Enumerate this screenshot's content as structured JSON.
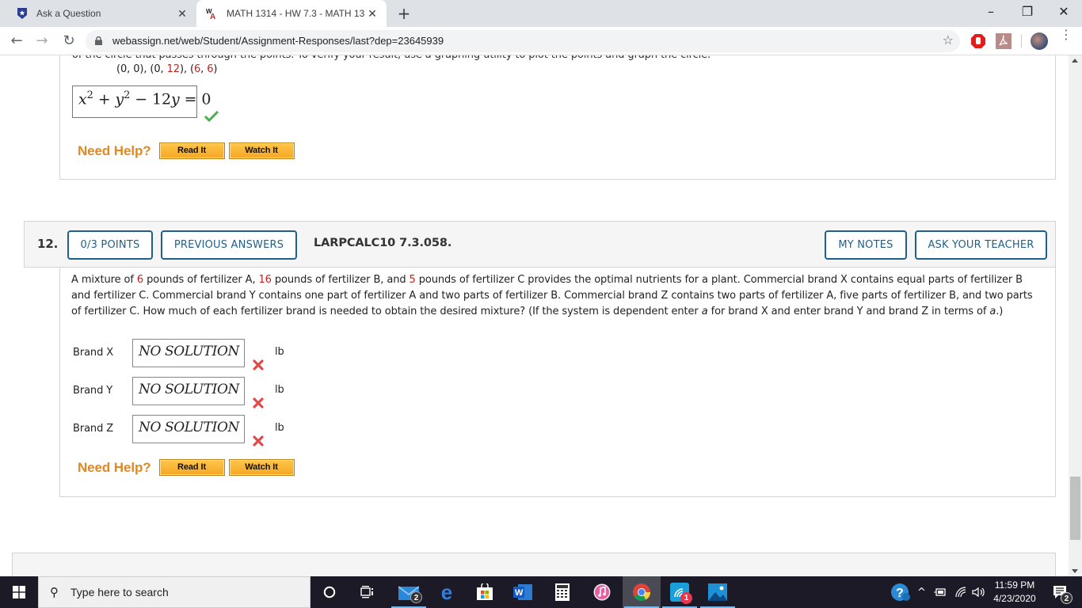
{
  "browser": {
    "tabs": [
      {
        "title": "Ask a Question",
        "icon": "shield-star-icon",
        "active": false
      },
      {
        "title": "MATH 1314 - HW 7.3 - MATH 13",
        "icon": "webassign-icon",
        "active": true
      }
    ],
    "new_tab": "+",
    "window_controls": {
      "minimize": "–",
      "restore": "❐",
      "close": "✕"
    },
    "nav": {
      "back": "←",
      "forward": "→",
      "reload": "↻"
    },
    "url": "webassign.net/web/Student/Assignment-Responses/last?dep=23645939",
    "bookmark_icon": "☆",
    "extensions": [
      "adblock-icon",
      "acrobat-icon"
    ],
    "menu": "⋮"
  },
  "previous_question": {
    "cut_text": "of the circle that passes through the points. To verify your result, use a graphing utility to plot the points and graph the circle.",
    "points_text": [
      {
        "text": "(0, 0), (0, ",
        "red": false
      },
      {
        "text": "12",
        "red": true
      },
      {
        "text": "), (",
        "red": false
      },
      {
        "text": "6",
        "red": true
      },
      {
        "text": ", ",
        "red": false
      },
      {
        "text": "6",
        "red": true
      },
      {
        "text": ")",
        "red": false
      }
    ],
    "answer": {
      "x": "x",
      "sup1": "2",
      "plus": " + ",
      "y": "y",
      "sup2": "2",
      "rest": " − 12",
      "y2": "y",
      "eq": " = 0"
    },
    "status": "correct",
    "need_help": {
      "label": "Need Help?",
      "read": "Read It",
      "watch": "Watch It"
    }
  },
  "question": {
    "number": "12.",
    "points_button": "0/3 POINTS",
    "previous_answers_button": "PREVIOUS ANSWERS",
    "code": "LARPCALC10 7.3.058.",
    "my_notes_button": "MY NOTES",
    "ask_teacher_button": "ASK YOUR TEACHER",
    "problem_segments": [
      {
        "text": "A mixture of ",
        "style": "normal"
      },
      {
        "text": "6",
        "style": "red"
      },
      {
        "text": " pounds of fertilizer A, ",
        "style": "normal"
      },
      {
        "text": "16",
        "style": "red"
      },
      {
        "text": " pounds of fertilizer B, and ",
        "style": "normal"
      },
      {
        "text": "5",
        "style": "red"
      },
      {
        "text": " pounds of fertilizer C provides the optimal nutrients for a plant. Commercial brand X contains equal parts of fertilizer B and fertilizer C. Commercial brand Y contains one part of fertilizer A and two parts of fertilizer B. Commercial brand Z contains two parts of fertilizer A, five parts of fertilizer B, and two parts of fertilizer C. How much of each fertilizer brand is needed to obtain the desired mixture? (If the system is dependent enter ",
        "style": "normal"
      },
      {
        "text": "a",
        "style": "italic"
      },
      {
        "text": " for brand X and enter brand Y and brand Z in terms of ",
        "style": "normal"
      },
      {
        "text": "a",
        "style": "italic"
      },
      {
        "text": ".)",
        "style": "normal"
      }
    ],
    "answers": [
      {
        "label": "Brand X",
        "value": "NO SOLUTION",
        "unit": "lb",
        "status": "incorrect"
      },
      {
        "label": "Brand Y",
        "value": "NO SOLUTION",
        "unit": "lb",
        "status": "incorrect"
      },
      {
        "label": "Brand Z",
        "value": "NO SOLUTION",
        "unit": "lb",
        "status": "incorrect"
      }
    ],
    "need_help": {
      "label": "Need Help?",
      "read": "Read It",
      "watch": "Watch It"
    }
  },
  "colors": {
    "accent_blue": "#1f5f8b",
    "help_orange": "#e2881f",
    "given_red": "#c41e1e",
    "correct_green": "#4caf50",
    "incorrect_red": "#e04a4a"
  },
  "taskbar": {
    "search_placeholder": "Type here to search",
    "apps": [
      {
        "name": "cortana-icon"
      },
      {
        "name": "task-view-icon"
      },
      {
        "name": "mail-icon",
        "badge": "2"
      },
      {
        "name": "edge-icon"
      },
      {
        "name": "store-icon"
      },
      {
        "name": "word-icon"
      },
      {
        "name": "calculator-icon"
      },
      {
        "name": "itunes-icon"
      },
      {
        "name": "chrome-icon",
        "active": true
      },
      {
        "name": "connect-icon",
        "badge": "1"
      },
      {
        "name": "photos-icon"
      }
    ],
    "tray": {
      "time": "11:59 PM",
      "date": "4/23/2020",
      "notifications": "2"
    }
  }
}
